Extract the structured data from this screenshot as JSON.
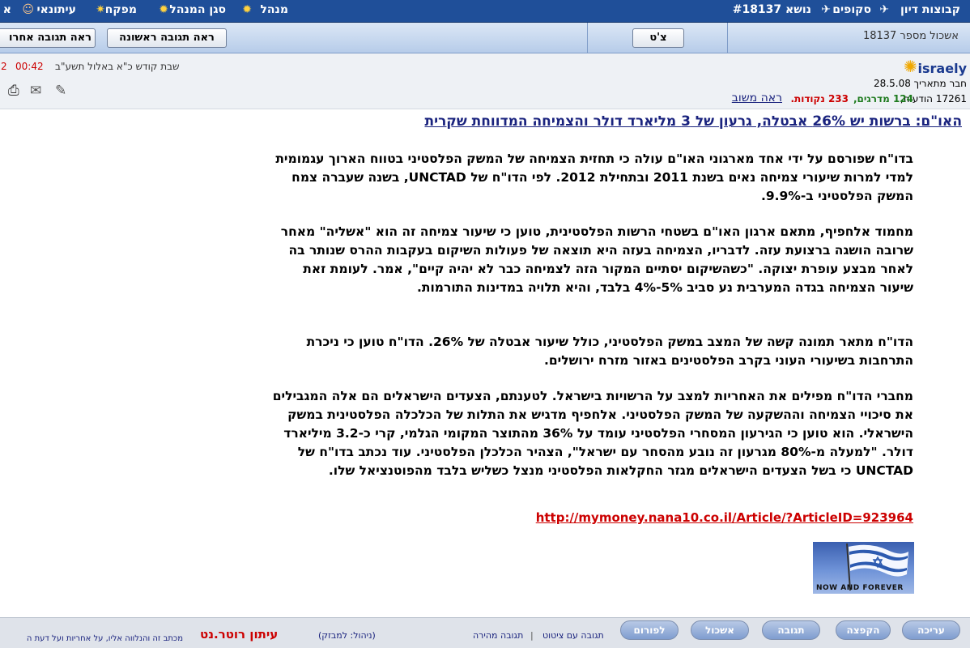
{
  "topbar": {
    "items": [
      "קבוצות דיון",
      "סקופים",
      "נושא #18137",
      "מנהל",
      "סגן המנהל",
      "מפקח",
      "עיתונאי",
      "א"
    ]
  },
  "toolbar": {
    "thread_label": "אשכול מספר 18137",
    "chat_button": "צ'ט",
    "first_reply_button": "ראה תגובה ראשונה",
    "last_reply_button": "ראה תגובה אחרו"
  },
  "user": {
    "name": "israely",
    "member_since": "חבר מתאריך 28.5.08",
    "messages_label": "17261 הודעות,",
    "ratings": "124 מדרגים,",
    "points": "233 נקודות.",
    "see_reply": "ראה משוב"
  },
  "date_info": {
    "hebrew_date": "שבת קודש כ\"א באלול תשע\"ב",
    "time": "00:42",
    "extra": "2"
  },
  "article": {
    "title": "האו\"ם: ברשות יש 26% אבטלה, גרעון של 3 מליארד דולר והצמיחה המדווחת שקרית",
    "paragraphs": [
      "בדו\"ח שפורסם על ידי אחד מארגוני האו\"ם עולה כי תחזית הצמיחה של המשק הפלסטיני בטווח הארוך עגמומית למדי למרות שיעורי צמיחה נאים בשנת 2011 ובתחילת 2012. לפי הדו\"ח של UNCTAD, בשנה שעברה צמח המשק הפלסטיני ב-9.9%.",
      "מחמוד אלחפיף, מתאם ארגון האו\"ם בשטחי הרשות הפלסטינית, טוען כי שיעור צמיחה זה הוא \"אשליה\" מאחר שרובה הושגה ברצועת עזה. לדבריו, הצמיחה בעזה היא תוצאה של פעולות השיקום בעקבות ההרס שנותר בה לאחר מבצע עופרת יצוקה. \"כשהשיקום יסתיים המקור הזה לצמיחה כבר לא יהיה קיים\", אמר. לעומת זאת שיעור הצמיחה בגדה המערבית נע סביב 5%-4% בלבד, והיא תלויה במדינות התורמות.",
      "הדו\"ח מתאר תמונה קשה של המצב במשק הפלסטיני, כולל שיעור אבטלה של 26%. הדו\"ח טוען כי ניכרת התרחבות בשיעורי העוני בקרב הפלסטינים באזור מזרח ירושלים.",
      "מחברי הדו\"ח מפילים את האחריות למצב על הרשויות בישראל. לטענתם, הצעדים הישראלים הם אלה המגבילים את סיכויי הצמיחה וההשקעה של המשק הפלסטיני. אלחפיף מדגיש את התלות של הכלכלה הפלסטינית במשק הישראלי. הוא טוען כי הגירעון המסחרי הפלסטיני עומד על 36% מהתוצר המקומי הגלמי, קרי כ-3.2 מיליארד דולר. \"למעלה מ-80% מגרעון זה נובע מהסחר עם ישראל\", הצהיר הכלכלן הפלסטיני. עוד נכתב בדו\"ח של UNCTAD כי בשל הצעדים הישראלים מגזר החקלאות הפלסטיני מנצל כשליש בלבד מהפוטנציאל שלו."
    ],
    "url": "http://mymoney.nana10.co.il/Article/?ArticleID=923964",
    "image_caption": "NOW AND FOREVER"
  },
  "bottombar": {
    "buttons": [
      "עריכה",
      "הקפצה",
      "תגובה",
      "אשכול",
      "לפורום"
    ],
    "quote_reply": "תגובה עם ציטוט",
    "separator": "|",
    "quick_reply": "תגובה מהירה",
    "moderation": "(ניהול: למבזק)",
    "brand": "עיתון רוטר.נט",
    "disclaimer": "מכתב זה והנלווה אליו, על אחריות ועל דעת ה"
  },
  "colors": {
    "topbar": "#1f4f99",
    "title": "#1a237e",
    "url": "#cc0000",
    "time": "#cc0000",
    "brand": "#cc0000"
  }
}
